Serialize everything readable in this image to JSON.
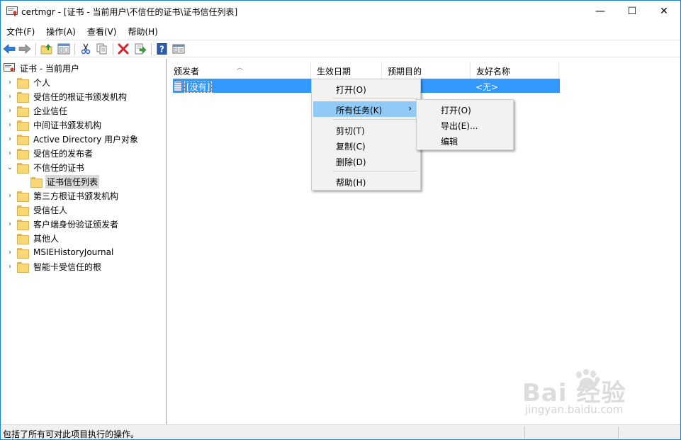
{
  "window": {
    "title": "certmgr - [证书 - 当前用户\\不信任的证书\\证书信任列表]",
    "min_glyph": "—",
    "max_glyph": "☐",
    "close_glyph": "✕"
  },
  "menubar": {
    "items": [
      "文件(F)",
      "操作(A)",
      "查看(V)",
      "帮助(H)"
    ]
  },
  "toolbar": {
    "buttons": [
      "back-icon",
      "forward-icon",
      "up-folder-icon",
      "show-hide-tree-icon",
      "cut-icon",
      "copy-icon",
      "delete-icon",
      "export-icon",
      "help-icon",
      "properties-icon"
    ]
  },
  "tree": {
    "root": "证书 - 当前用户",
    "items": [
      {
        "label": "个人",
        "expanded": false
      },
      {
        "label": "受信任的根证书颁发机构",
        "expanded": false
      },
      {
        "label": "企业信任",
        "expanded": false
      },
      {
        "label": "中间证书颁发机构",
        "expanded": false
      },
      {
        "label": "Active Directory 用户对象",
        "expanded": false
      },
      {
        "label": "受信任的发布者",
        "expanded": false
      },
      {
        "label": "不信任的证书",
        "expanded": true
      },
      {
        "label": "证书信任列表",
        "expanded": false,
        "selected": true
      },
      {
        "label": "第三方根证书颁发机构",
        "expanded": false
      },
      {
        "label": "受信任人",
        "expanded": false
      },
      {
        "label": "客户端身份验证颁发者",
        "expanded": false
      },
      {
        "label": "其他人",
        "expanded": false
      },
      {
        "label": "MSIEHistoryJournal",
        "expanded": false
      },
      {
        "label": "智能卡受信任的根",
        "expanded": false
      }
    ]
  },
  "list": {
    "columns": [
      "颁发者",
      "生效日期",
      "预期目的",
      "友好名称"
    ],
    "rows": [
      {
        "issuer": "[没有]",
        "friendly_name": "<无>"
      }
    ]
  },
  "context_menu": {
    "items": [
      "打开(O)",
      "所有任务(K)",
      "剪切(T)",
      "复制(C)",
      "删除(D)",
      "帮助(H)"
    ],
    "submenu_arrow": "›"
  },
  "submenu": {
    "items": [
      "打开(O)",
      "导出(E)...",
      "编辑"
    ]
  },
  "status": {
    "text": "包括了所有可对此项目执行的操作。"
  },
  "watermark": {
    "brand": "Bai 经验",
    "url": "jingyan.baidu.com"
  },
  "colors": {
    "selection": "#3399ff",
    "menu_highlight": "#91c9f7",
    "window_border": "#1883d7"
  }
}
